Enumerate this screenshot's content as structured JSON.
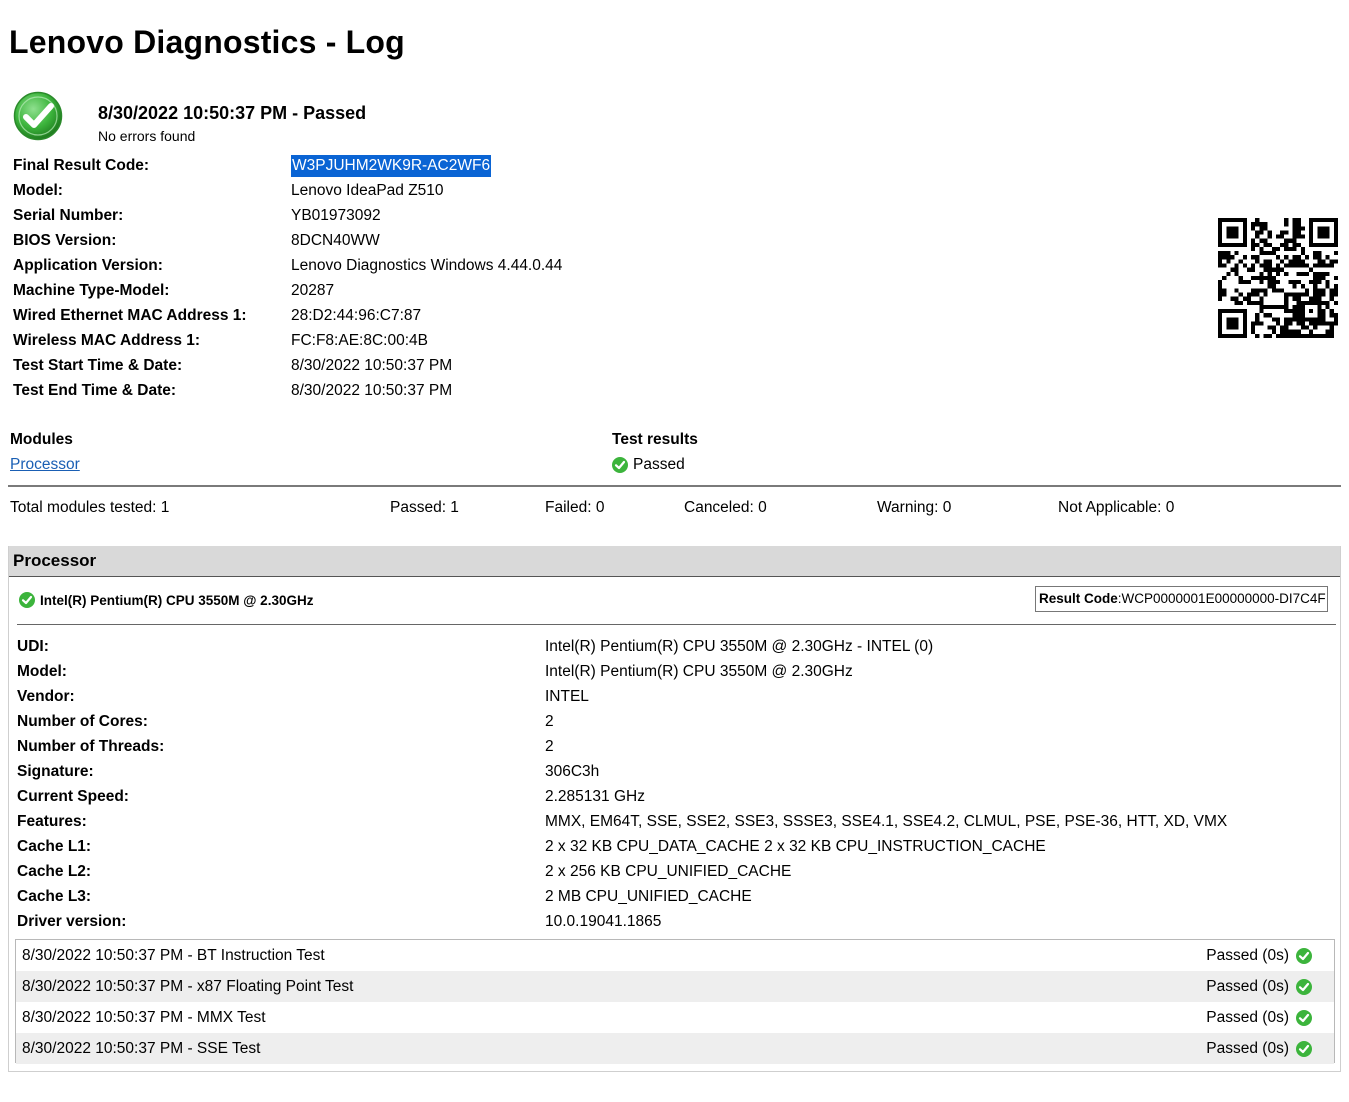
{
  "page": {
    "title": "Lenovo Diagnostics - Log",
    "status_line": "8/30/2022 10:50:37 PM - Passed",
    "status_sub": "No errors found"
  },
  "info": [
    {
      "label": "Final Result Code:",
      "value": "W3PJUHM2WK9R-AC2WF6"
    },
    {
      "label": "Model:",
      "value": "Lenovo IdeaPad Z510"
    },
    {
      "label": "Serial Number:",
      "value": "YB01973092"
    },
    {
      "label": "BIOS Version:",
      "value": "8DCN40WW"
    },
    {
      "label": "Application Version:",
      "value": "Lenovo Diagnostics Windows 4.44.0.44"
    },
    {
      "label": "Machine Type-Model:",
      "value": "20287"
    },
    {
      "label": "Wired Ethernet MAC Address 1:",
      "value": "28:D2:44:96:C7:87"
    },
    {
      "label": "Wireless MAC Address 1:",
      "value": "FC:F8:AE:8C:00:4B"
    },
    {
      "label": "Test Start Time & Date:",
      "value": "8/30/2022 10:50:37 PM"
    },
    {
      "label": "Test End Time & Date:",
      "value": "8/30/2022 10:50:37 PM"
    }
  ],
  "modules": {
    "col_modules": "Modules",
    "col_results": "Test results",
    "module_name": "Processor",
    "module_result": "Passed"
  },
  "totals": {
    "total": "Total modules tested: 1",
    "passed": "Passed: 1",
    "failed": "Failed: 0",
    "canceled": "Canceled: 0",
    "warning": "Warning: 0",
    "not_applicable": "Not Applicable: 0"
  },
  "processor": {
    "header": "Processor",
    "cpu_name": "Intel(R) Pentium(R) CPU 3550M @ 2.30GHz",
    "result_code_label": "Result Code",
    "result_code_value": ":WCP0000001E00000000-DI7C4F",
    "details": [
      {
        "label": "UDI:",
        "value": "Intel(R) Pentium(R) CPU 3550M @ 2.30GHz - INTEL (0)"
      },
      {
        "label": "Model:",
        "value": "Intel(R) Pentium(R) CPU 3550M @ 2.30GHz"
      },
      {
        "label": "Vendor:",
        "value": "INTEL"
      },
      {
        "label": "Number of Cores:",
        "value": "2"
      },
      {
        "label": "Number of Threads:",
        "value": "2"
      },
      {
        "label": "Signature:",
        "value": "306C3h"
      },
      {
        "label": "Current Speed:",
        "value": "2.285131 GHz"
      },
      {
        "label": "Features:",
        "value": "MMX, EM64T, SSE, SSE2, SSE3, SSSE3, SSE4.1, SSE4.2, CLMUL, PSE, PSE-36, HTT, XD, VMX"
      },
      {
        "label": "Cache L1:",
        "value": "2 x 32 KB CPU_DATA_CACHE 2 x 32 KB CPU_INSTRUCTION_CACHE"
      },
      {
        "label": "Cache L2:",
        "value": "2 x 256 KB CPU_UNIFIED_CACHE"
      },
      {
        "label": "Cache L3:",
        "value": "2 MB CPU_UNIFIED_CACHE"
      },
      {
        "label": "Driver version:",
        "value": "10.0.19041.1865"
      }
    ],
    "tests": [
      {
        "name": "8/30/2022 10:50:37 PM - BT Instruction Test",
        "result": "Passed (0s)"
      },
      {
        "name": "8/30/2022 10:50:37 PM - x87 Floating Point Test",
        "result": "Passed (0s)"
      },
      {
        "name": "8/30/2022 10:50:37 PM - MMX Test",
        "result": "Passed (0s)"
      },
      {
        "name": "8/30/2022 10:50:37 PM - SSE Test",
        "result": "Passed (0s)"
      }
    ]
  },
  "colors": {
    "pass_green": "#3cb43c",
    "link_blue": "#1a5fb4",
    "selection_blue": "#0a64d4",
    "header_gray": "#d9d9d9"
  },
  "icons": {
    "status": "check-circle-icon",
    "qr": "qr-code-icon"
  }
}
